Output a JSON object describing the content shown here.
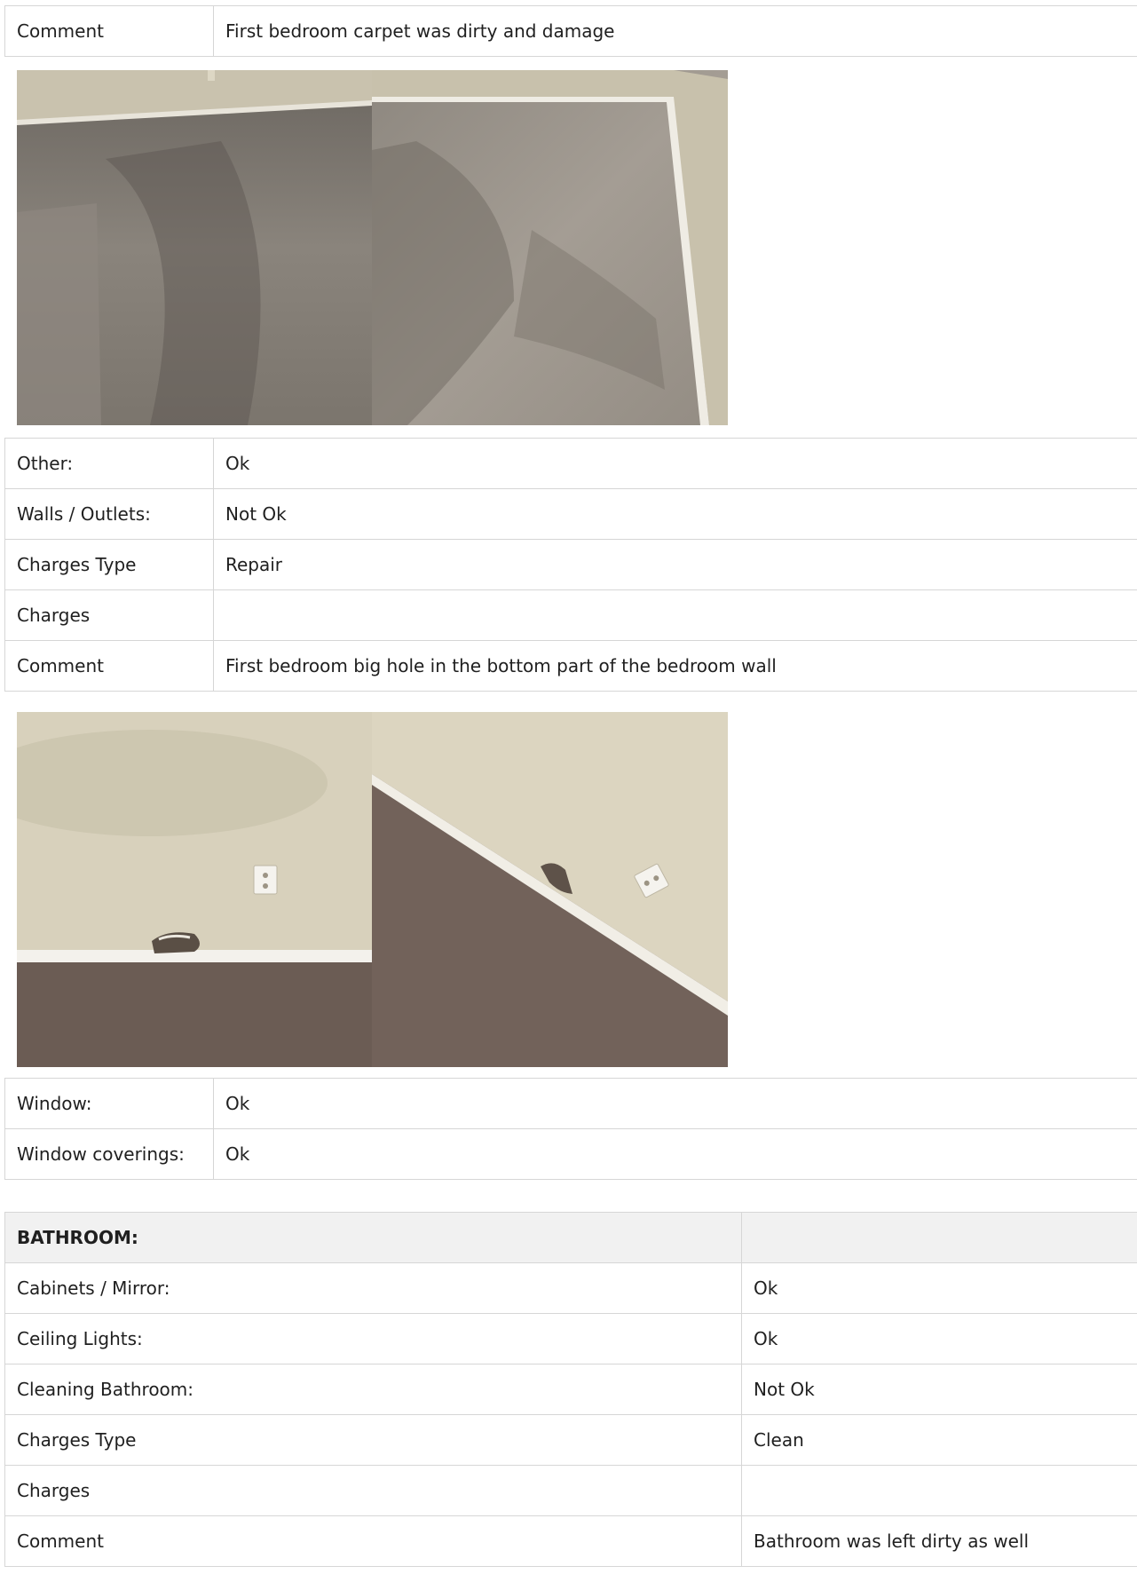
{
  "section1": {
    "comment_label": "Comment",
    "comment_value": "First bedroom carpet was dirty and damage"
  },
  "carpet_photos": {
    "description_icon": "photo-carpet"
  },
  "section2": {
    "rows": [
      {
        "label": "Other:",
        "value": "Ok"
      },
      {
        "label": "Walls / Outlets:",
        "value": "Not Ok"
      },
      {
        "label": "Charges Type",
        "value": "Repair"
      },
      {
        "label": "Charges",
        "value": ""
      },
      {
        "label": "Comment",
        "value": "First bedroom big hole in the bottom part of the bedroom wall"
      }
    ]
  },
  "wall_photos": {
    "description_icon": "photo-wall-hole"
  },
  "section3": {
    "rows": [
      {
        "label": "Window:",
        "value": "Ok"
      },
      {
        "label": "Window coverings:",
        "value": "Ok"
      }
    ]
  },
  "bathroom": {
    "title": "BATHROOM:",
    "header_value": "",
    "rows": [
      {
        "label": "Cabinets / Mirror:",
        "value": "Ok"
      },
      {
        "label": "Ceiling Lights:",
        "value": "Ok"
      },
      {
        "label": "Cleaning Bathroom:",
        "value": "Not Ok"
      },
      {
        "label": "Charges Type",
        "value": "Clean"
      },
      {
        "label": "Charges",
        "value": ""
      },
      {
        "label": "Comment",
        "value": "Bathroom was left dirty as well"
      }
    ]
  }
}
